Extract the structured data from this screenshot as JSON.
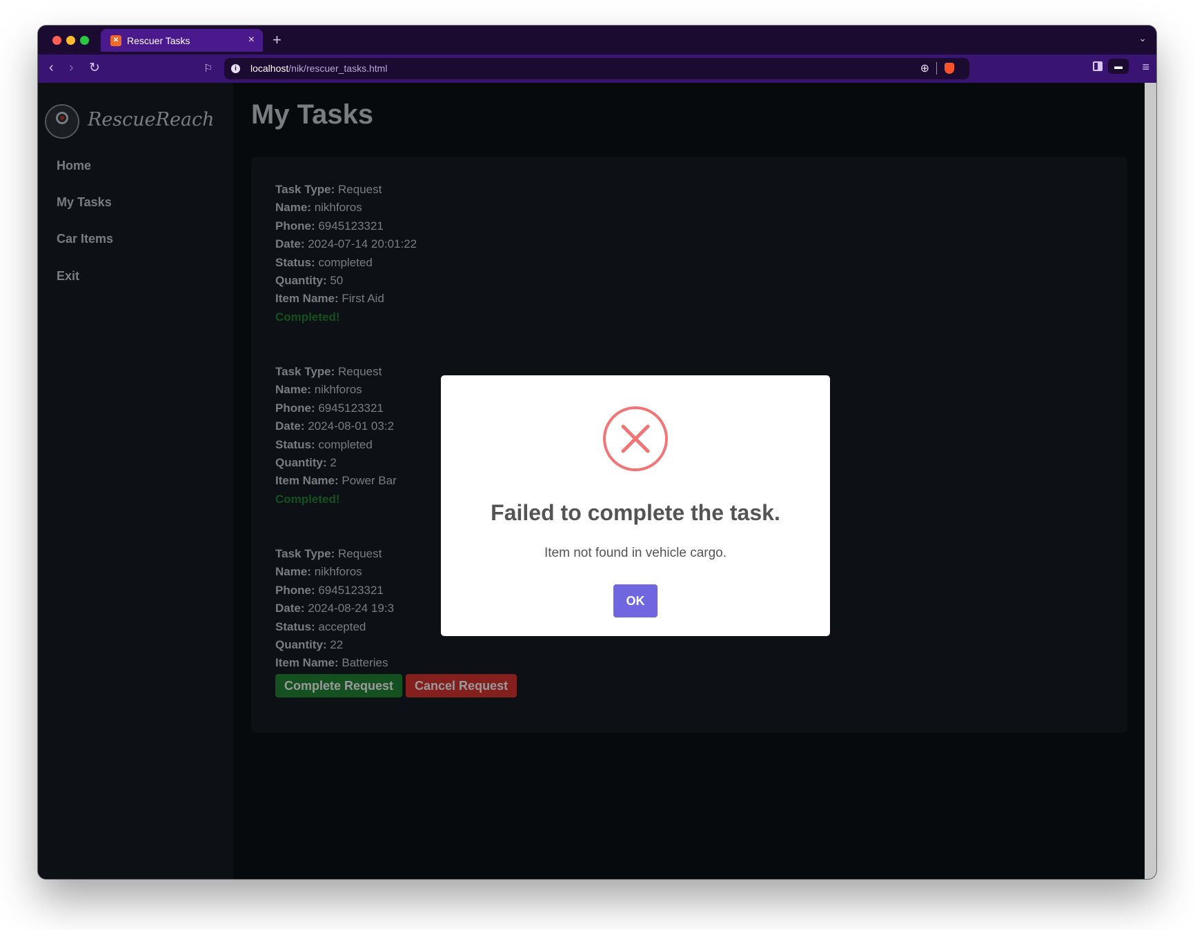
{
  "browser": {
    "tab_title": "Rescuer Tasks",
    "url_host": "localhost",
    "url_path": "/nik/rescuer_tasks.html"
  },
  "sidebar": {
    "brand": "RescueReach",
    "items": [
      {
        "label": "Home"
      },
      {
        "label": "My Tasks"
      },
      {
        "label": "Car Items"
      },
      {
        "label": "Exit"
      }
    ]
  },
  "main": {
    "title": "My Tasks",
    "field_labels": {
      "task_type": "Task Type:",
      "name": "Name:",
      "phone": "Phone:",
      "date": "Date:",
      "status": "Status:",
      "quantity": "Quantity:",
      "item_name": "Item Name:"
    },
    "tasks": [
      {
        "task_type": "Request",
        "name": "nikhforos",
        "phone": "6945123321",
        "date": "2024-07-14 20:01:22",
        "status": "completed",
        "quantity": "50",
        "item_name": "First Aid",
        "completed_label": "Completed!"
      },
      {
        "task_type": "Request",
        "name": "nikhforos",
        "phone": "6945123321",
        "date": "2024-08-01 03:2",
        "status": "completed",
        "quantity": "2",
        "item_name": "Power Bar",
        "completed_label": "Completed!"
      },
      {
        "task_type": "Request",
        "name": "nikhforos",
        "phone": "6945123321",
        "date": "2024-08-24 19:3",
        "status": "accepted",
        "quantity": "22",
        "item_name": "Batteries",
        "complete_button": "Complete Request",
        "cancel_button": "Cancel Request"
      }
    ]
  },
  "modal": {
    "title": "Failed to complete the task.",
    "text": "Item not found in vehicle cargo.",
    "ok_label": "OK",
    "icon": "error-x-icon"
  },
  "colors": {
    "accent": "#7066e0",
    "error": "#f27474",
    "success": "#238636",
    "danger": "#da3633",
    "browser_chrome": "#3a1473"
  }
}
